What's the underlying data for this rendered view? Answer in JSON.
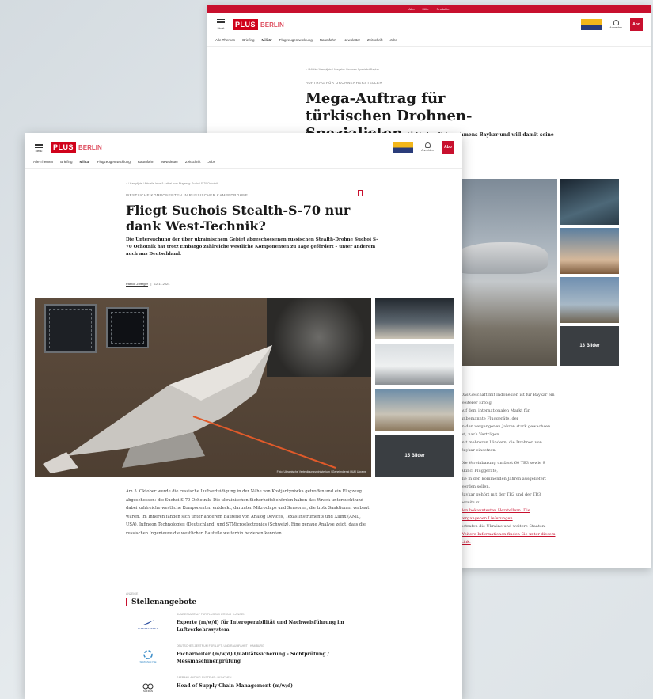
{
  "back": {
    "top_links": [
      "Abo",
      "Hilfe",
      "Produkte"
    ],
    "menu_label": "Menü",
    "logo_plus": "PLUS",
    "logo_sub": "BERLIN",
    "account_label": "Anmelden",
    "cta": "Abo",
    "nav": [
      "Alle Themen",
      "Briefing",
      "Militär",
      "Flugzeugentwicklung",
      "Raumfahrt",
      "Newsletter",
      "Zeitschrift",
      "Jobs"
    ],
    "breadcrumb": "⌂  /  Militär  /  Kampfjets  /  Ausgabe: Drohnen-Spezialist Baykar",
    "kicker": "AUFTRAG FÜR DROHNENHERSTELLER",
    "title": "Mega-Auftrag für türkischen Drohnen-Spezialisten",
    "lead": "Indonesien kauft fast 70 Drohnen des türkischen Unternehmens Baykar und will damit seine Luftstreitkräfte mit unbemannten Fluggeräte aufrüsten.",
    "more_images": "13 Bilder",
    "body": [
      "Das Geschäft mit Indonesien ist für Baykar ein weiterer Erfolg",
      "auf dem internationalen Markt für unbemannte Fluggeräte, der",
      "in den vergangenen Jahren stark gewachsen ist, nach Verträgen",
      "mit mehreren Ländern, die Drohnen von Baykar einsetzen."
    ],
    "body2": [
      "Die Vereinbarung umfasst 60 TB3 sowie 9 Akinci Fluggeräte,",
      "die in den kommenden Jahren ausgeliefert werden sollen.",
      "Baykar gehört mit der TB2 und der TB3 bereits zu",
      "den bekanntesten Herstellern. Die vergangenen Lieferungen",
      "betrafen die Ukraine und weitere Staaten.",
      "Weitere Informationen finden Sie unter diesem Link."
    ]
  },
  "front": {
    "menu_label": "Menü",
    "logo_plus": "PLUS",
    "logo_sub": "BERLIN",
    "account_label": "Anmelden",
    "cta": "Abo",
    "nav": [
      "Alle Themen",
      "Briefing",
      "Militär",
      "Flugzeugentwicklung",
      "Raumfahrt",
      "Newsletter",
      "Zeitschrift",
      "Jobs"
    ],
    "breadcrumb": "⌂  /  Kampfjets  /  Aktuelle Infos & Artikel zum Flugzeug: Suchoi S-70 Ochotnik",
    "kicker": "WESTLICHE KOMPONENTEN IN RUSSISCHER KAMPFDROHNE",
    "title": "Fliegt Suchois Stealth-S-70 nur dank West-Technik?",
    "lead": "Die Untersuchung der über ukrainischem Gebiet abgeschossenen russischen Stealth-Drohne Suchoi S-70 Ochotnik hat trotz Embargo zahlreiche westliche Komponenten zu Tage gefördert – unter anderem auch aus Deutschland.",
    "author": "Patrick Zwerger",
    "date": "12.11.2024",
    "caption": "Foto: Ukrainische Verteidigungsministerium / Geheimdienst HUR Ukraine",
    "more_images": "15 Bilder",
    "body_text": "Am 5. Oktober wurde die russische Luftverteidigung in der Nähe von Kostjantyniwka getroffen und ein Flugzeug abgeschossen: die Suchoi S-70 Ochotnik. Die ukrainischen Sicherheitsbehörden haben das Wrack untersucht und dabei zahlreiche westliche Komponenten entdeckt, darunter Mikrochips und Sensoren, die trotz Sanktionen verbaut waren. Im Inneren fanden sich unter anderem Bauteile von Analog Devices, Texas Instruments und Xilinx (AMD, USA), Infineon Technologies (Deutschland) und STMicroelectronics (Schweiz). Eine genaue Analyse zeigt, dass die russischen Ingenieure die westlichen Bauteile weiterhin beziehen konnten.",
    "anzeige": "ANZEIGE",
    "jobs_heading": "Stellenangebote",
    "jobs": [
      {
        "logo": "BUNDESANSTALT",
        "meta": "Bundesanstalt für Flugsicherung · Langen",
        "title": "Experte (m/w/d) für Interoperabilität und Nachweisführung im Luftverkehrssystem"
      },
      {
        "logo": "SEMIANALYSE",
        "meta": "Deutsches Zentrum für Luft- und Raumfahrt · Hamburg",
        "title": "Facharbeiter (m/w/d) Qualitätssicherung - Sichtprüfung / Messmaschinenprüfung"
      },
      {
        "logo": "SAFRAN",
        "meta": "Safran Landing Systems · München",
        "title": "Head of Supply Chain Management (m/w/d)"
      }
    ]
  }
}
